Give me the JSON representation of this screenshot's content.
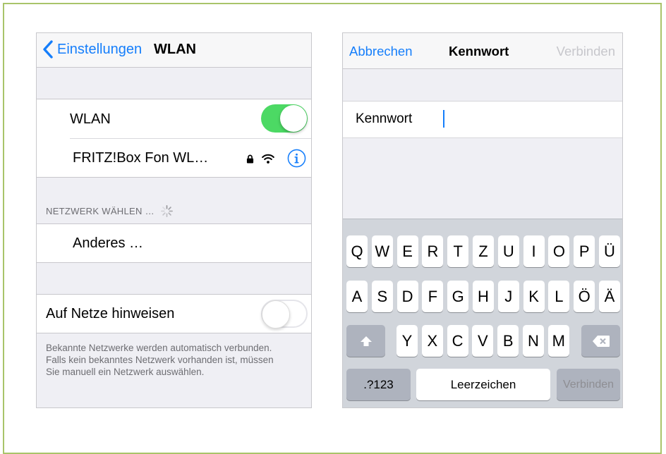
{
  "left_screen": {
    "nav": {
      "back_label": "Einstellungen",
      "title": "WLAN"
    },
    "wlan_row": {
      "label": "WLAN",
      "toggle_on": true
    },
    "network_row": {
      "name": "FRITZ!Box Fon WL…",
      "icons": [
        "lock-icon",
        "wifi-icon",
        "info-icon"
      ]
    },
    "section_header": "NETZWERK WÄHLEN …",
    "other_row": {
      "label": "Anderes …"
    },
    "ask_row": {
      "label": "Auf Netze hinweisen",
      "toggle_on": false
    },
    "footer_text": "Bekannte Netzwerke werden automatisch verbunden. Falls kein bekanntes Netzwerk vorhanden ist, müssen Sie manuell ein Netzwerk auswählen."
  },
  "right_screen": {
    "nav": {
      "cancel_label": "Abbrechen",
      "title": "Kennwort",
      "connect_label": "Verbinden"
    },
    "password": {
      "label": "Kennwort",
      "value": ""
    },
    "keyboard": {
      "row1": [
        "Q",
        "W",
        "E",
        "R",
        "T",
        "Z",
        "U",
        "I",
        "O",
        "P",
        "Ü"
      ],
      "row2": [
        "A",
        "S",
        "D",
        "F",
        "G",
        "H",
        "J",
        "K",
        "L",
        "Ö",
        "Ä"
      ],
      "row3": [
        "Y",
        "X",
        "C",
        "V",
        "B",
        "N",
        "M"
      ],
      "numbers_label": ".?123",
      "space_label": "Leerzeichen",
      "return_label": "Verbinden"
    }
  },
  "colors": {
    "accent": "#157efb",
    "toggle_on": "#4cd964",
    "frame": "#a9c46a",
    "keyboard_bg": "#d1d5db"
  }
}
